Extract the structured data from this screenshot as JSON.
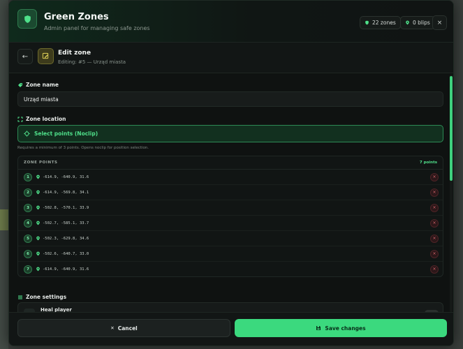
{
  "header": {
    "title": "Green Zones",
    "subtitle": "Admin panel for managing safe zones",
    "zones_badge": "22 zones",
    "blips_badge": "0 blips",
    "close_label": "×"
  },
  "subheader": {
    "back_label": "←",
    "title": "Edit zone",
    "subtitle": "Editing: #5 — Urząd miasta"
  },
  "zone_name": {
    "label": "Zone name",
    "value": "Urząd miasta"
  },
  "zone_location": {
    "label": "Zone location",
    "button_label": "Select points (Noclip)",
    "hint": "Requires a minimum of 3 points. Opens noclip for position selection."
  },
  "zone_points": {
    "title": "ZONE POINTS",
    "count": "7 points",
    "rows": [
      {
        "num": "1",
        "coords": "-614.9, -640.9, 31.6"
      },
      {
        "num": "2",
        "coords": "-614.9, -569.8, 34.1"
      },
      {
        "num": "3",
        "coords": "-502.8, -570.1, 33.9"
      },
      {
        "num": "4",
        "coords": "-502.7, -585.1, 33.7"
      },
      {
        "num": "5",
        "coords": "-502.3, -629.8, 34.6"
      },
      {
        "num": "6",
        "coords": "-502.6, -640.7, 33.0"
      },
      {
        "num": "7",
        "coords": "-614.9, -640.9, 31.6"
      }
    ],
    "delete_label": "×"
  },
  "zone_settings": {
    "label": "Zone settings",
    "first_item": "Heal player"
  },
  "footer": {
    "cancel_label": "Cancel",
    "save_label": "Save changes",
    "cancel_glyph": "✕"
  },
  "colors": {
    "accent": "#3bd97e",
    "background": "#0f1211",
    "danger": "#d96a6f"
  }
}
